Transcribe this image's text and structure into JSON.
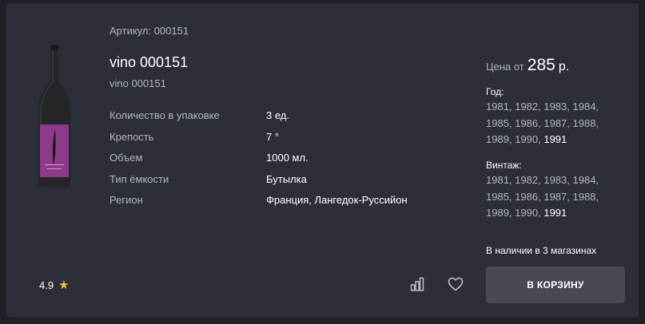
{
  "product": {
    "sku": "Артикул: 000151",
    "title": "vino 000151",
    "subtitle": "vino 000151",
    "bottle_label_color": "#8e3a8a"
  },
  "properties": [
    {
      "label": "Количество в упаковке",
      "value": "3 ед."
    },
    {
      "label": "Крепость",
      "value": "7 °"
    },
    {
      "label": "Объем",
      "value": "1000 мл."
    },
    {
      "label": "Тип ёмкости",
      "value": "Бутылка"
    },
    {
      "label": "Регион",
      "value": "Франция, Лангедок-Руссийон"
    }
  ],
  "price": {
    "prefix": "Цена от",
    "amount": "285",
    "currency": "р."
  },
  "year": {
    "title": "Год:",
    "values": [
      "1981,",
      "1982,",
      "1983,",
      "1984,",
      "1985,",
      "1986,",
      "1987,",
      "1988,",
      "1989,",
      "1990,",
      "1991"
    ]
  },
  "vintage": {
    "title": "Винтаж:",
    "values": [
      "1981,",
      "1982,",
      "1983,",
      "1984,",
      "1985,",
      "1986,",
      "1987,",
      "1988,",
      "1989,",
      "1990,",
      "1991"
    ]
  },
  "stock_text": "В наличии в 3 магазинах",
  "rating": {
    "value": "4.9",
    "icon": "star-icon"
  },
  "actions": {
    "compare_icon": "bar-chart-icon",
    "favorite_icon": "heart-icon",
    "cart_label": "В КОРЗИНУ"
  },
  "colors": {
    "background": "#1e2026",
    "card": "#2c2f37",
    "button": "#474a54",
    "muted_text": "#b4b7bf",
    "star": "#f0c33c"
  }
}
